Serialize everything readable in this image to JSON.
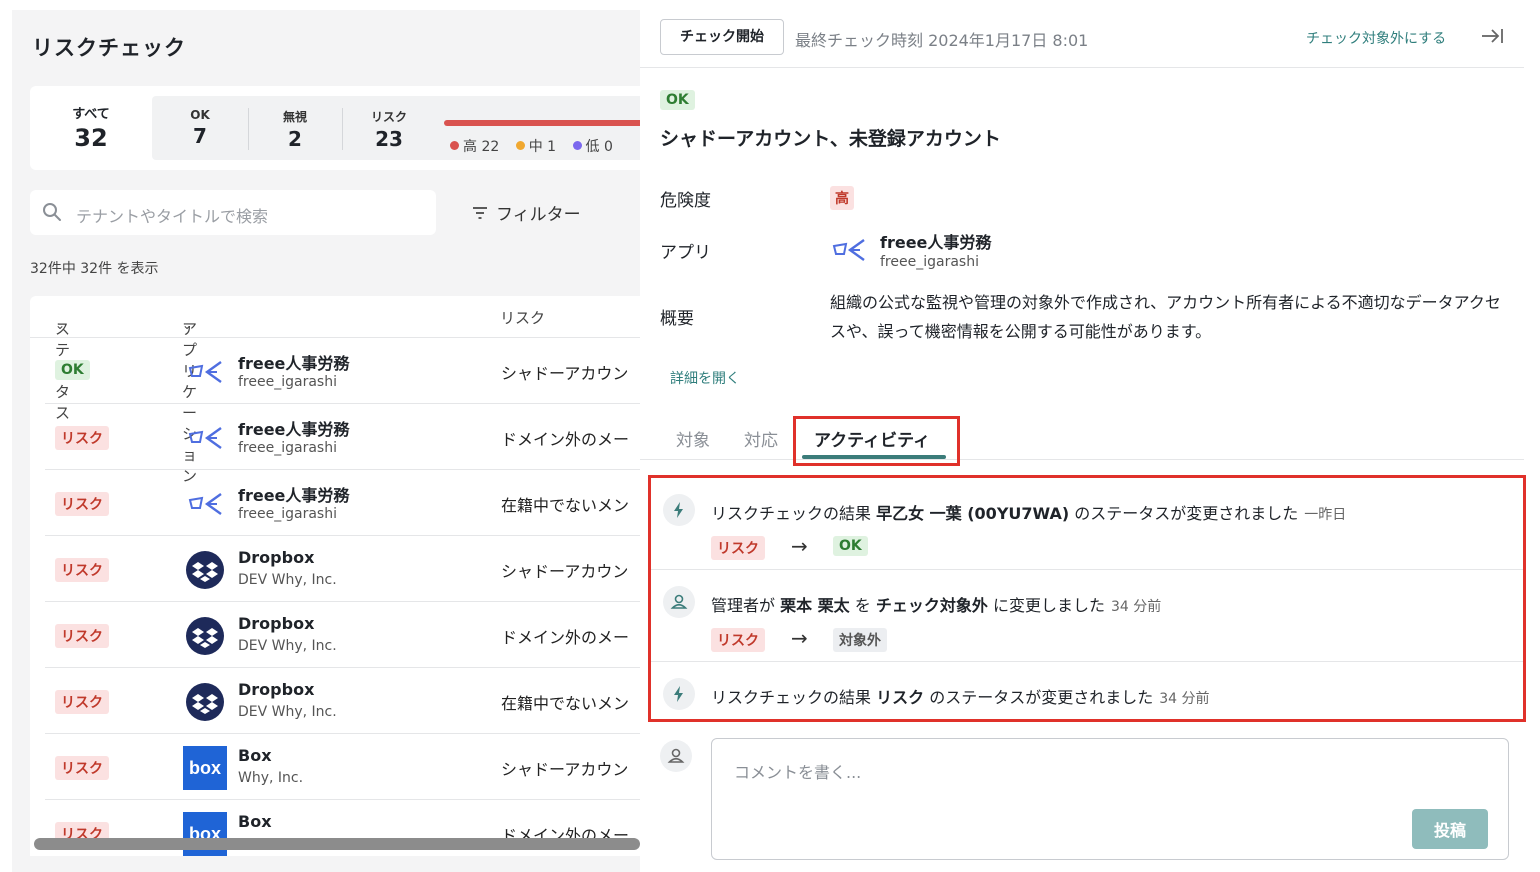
{
  "left": {
    "title": "リスクチェック",
    "summary": {
      "all": {
        "label": "すべて",
        "value": "32"
      },
      "ok": {
        "label": "OK",
        "value": "7"
      },
      "ignore": {
        "label": "無視",
        "value": "2"
      },
      "risk": {
        "label": "リスク",
        "value": "23"
      },
      "legend": [
        {
          "label": "高 22",
          "color": "#d9534f"
        },
        {
          "label": "中 1",
          "color": "#f0a830"
        },
        {
          "label": "低 0",
          "color": "#7b68ee"
        }
      ]
    },
    "search": {
      "placeholder": "テナントやタイトルで検索",
      "icon": "search-icon"
    },
    "filter_label": "フィルター",
    "count_text": "32件中 32件 を表示",
    "columns": {
      "status": "ステータス",
      "application": "アプリケーション",
      "risk": "リスク"
    },
    "rows": [
      {
        "status": "OK",
        "status_type": "ok",
        "app": "freee人事労務",
        "tenant": "freee_igarashi",
        "risk": "シャドーアカウン",
        "logo": "freee"
      },
      {
        "status": "リスク",
        "status_type": "risk",
        "app": "freee人事労務",
        "tenant": "freee_igarashi",
        "risk": "ドメイン外のメー",
        "logo": "freee"
      },
      {
        "status": "リスク",
        "status_type": "risk",
        "app": "freee人事労務",
        "tenant": "freee_igarashi",
        "risk": "在籍中でないメン",
        "logo": "freee"
      },
      {
        "status": "リスク",
        "status_type": "risk",
        "app": "Dropbox",
        "tenant": "DEV Why, Inc.",
        "risk": "シャドーアカウン",
        "logo": "dropbox"
      },
      {
        "status": "リスク",
        "status_type": "risk",
        "app": "Dropbox",
        "tenant": "DEV Why, Inc.",
        "risk": "ドメイン外のメー",
        "logo": "dropbox"
      },
      {
        "status": "リスク",
        "status_type": "risk",
        "app": "Dropbox",
        "tenant": "DEV Why, Inc.",
        "risk": "在籍中でないメン",
        "logo": "dropbox"
      },
      {
        "status": "リスク",
        "status_type": "risk",
        "app": "Box",
        "tenant": "Why, Inc.",
        "risk": "シャドーアカウン",
        "logo": "box"
      },
      {
        "status": "リスク",
        "status_type": "risk",
        "app": "Box",
        "tenant": "",
        "risk": "ドメイン外のメー",
        "logo": "box"
      }
    ]
  },
  "right": {
    "check_button": "チェック開始",
    "last_check": "最終チェック時刻 2024年1月17日 8:01",
    "exclude_link": "チェック対象外にする",
    "status": "OK",
    "title": "シャドーアカウント、未登録アカウント",
    "labels": {
      "danger": "危険度",
      "app": "アプリ",
      "overview": "概要"
    },
    "danger_value": "高",
    "app_name": "freee人事労務",
    "app_tenant": "freee_igarashi",
    "overview": "組織の公式な監視や管理の対象外で作成され、アカウント所有者による不適切なデータアクセスや、誤って機密情報を公開する可能性があります。",
    "details_link": "詳細を開く",
    "tabs": [
      "対象",
      "対応",
      "アクティビティ"
    ],
    "activities": [
      {
        "icon": "lightning-icon",
        "pre": "リスクチェックの結果 ",
        "bold1": "早乙女 一葉 (00YU7WA)",
        "mid": " のステータスが変更されました",
        "time": "一昨日",
        "from": "リスク",
        "to": "OK"
      },
      {
        "icon": "user-icon",
        "pre": "管理者が ",
        "bold1": "栗本 栗太",
        "mid": " を ",
        "bold2": "チェック対象外",
        "post": " に変更しました",
        "time": "34 分前",
        "from": "リスク",
        "to": "対象外"
      },
      {
        "icon": "lightning-icon",
        "pre": "リスクチェックの結果 ",
        "bold1": "リスク",
        "mid": " のステータスが変更されました",
        "time": "34 分前"
      }
    ],
    "comment_placeholder": "コメントを書く...",
    "post_button": "投稿"
  }
}
